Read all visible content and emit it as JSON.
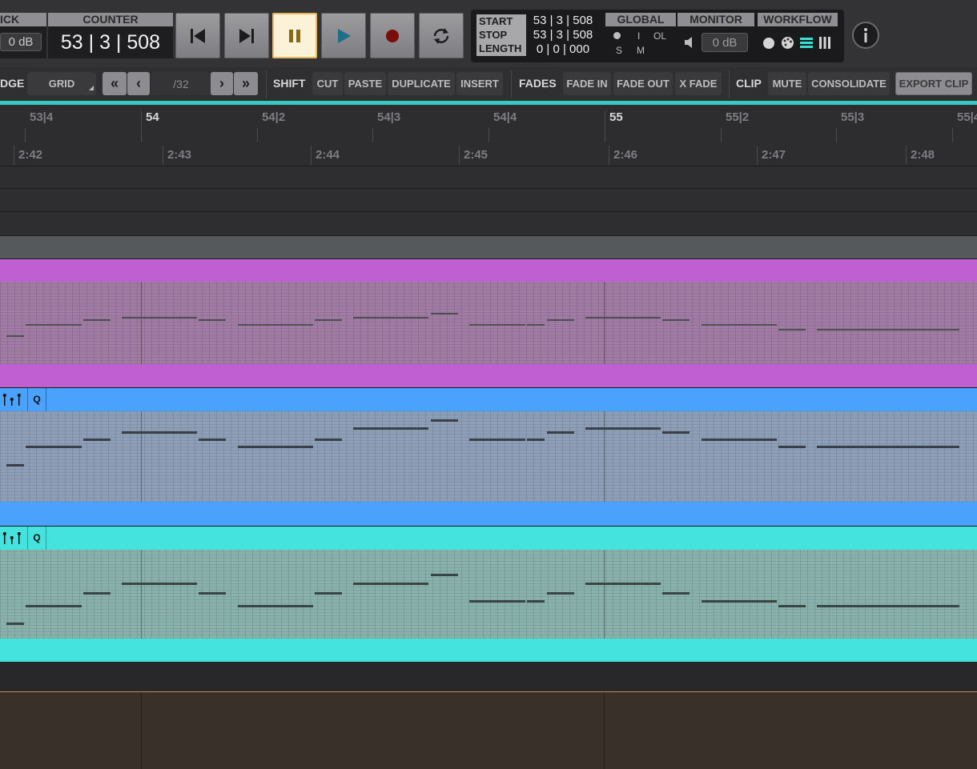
{
  "transport": {
    "click_label": "ICK",
    "click_value": "0 dB",
    "counter_label": "COUNTER",
    "counter_value": "53 | 3 | 508",
    "start_label": "START",
    "stop_label": "STOP",
    "length_label": "LENGTH",
    "start_value": "53 | 3 | 508",
    "stop_value": "53 | 3 | 508",
    "length_value": "0 | 0 | 000",
    "global_label": "GLOBAL",
    "global_i": "I",
    "global_ol": "OL",
    "global_s": "S",
    "global_m": "M",
    "monitor_label": "MONITOR",
    "monitor_value": "0 dB",
    "workflow_label": "WORKFLOW",
    "info_icon": "info-icon",
    "pause_active_color": "#fbf2d8"
  },
  "toolbar": {
    "edge_label": "DGE",
    "grid_label": "GRID",
    "division": "/32",
    "shift_label": "SHIFT",
    "cut": "CUT",
    "paste": "PASTE",
    "duplicate": "DUPLICATE",
    "insert": "INSERT",
    "fades_label": "FADES",
    "fade_in": "FADE IN",
    "fade_out": "FADE OUT",
    "x_fade": "X FADE",
    "clip_label": "CLIP",
    "mute": "MUTE",
    "consolidate": "CONSOLIDATE",
    "export_clip": "EXPORT CLIP"
  },
  "ruler": {
    "bars": [
      "53|4",
      "54",
      "54|2",
      "54|3",
      "54|4",
      "55",
      "55|2",
      "55|3",
      "55|4"
    ],
    "times": [
      "2:42",
      "2:43",
      "2:44",
      "2:45",
      "2:46",
      "2:47",
      "2:48"
    ]
  },
  "tracks": {
    "q_label": "Q",
    "colors": {
      "purple": "#c05fd2",
      "blue": "#4aa2fc",
      "cyan": "#45e3de",
      "bottom": "#3a302a"
    }
  }
}
